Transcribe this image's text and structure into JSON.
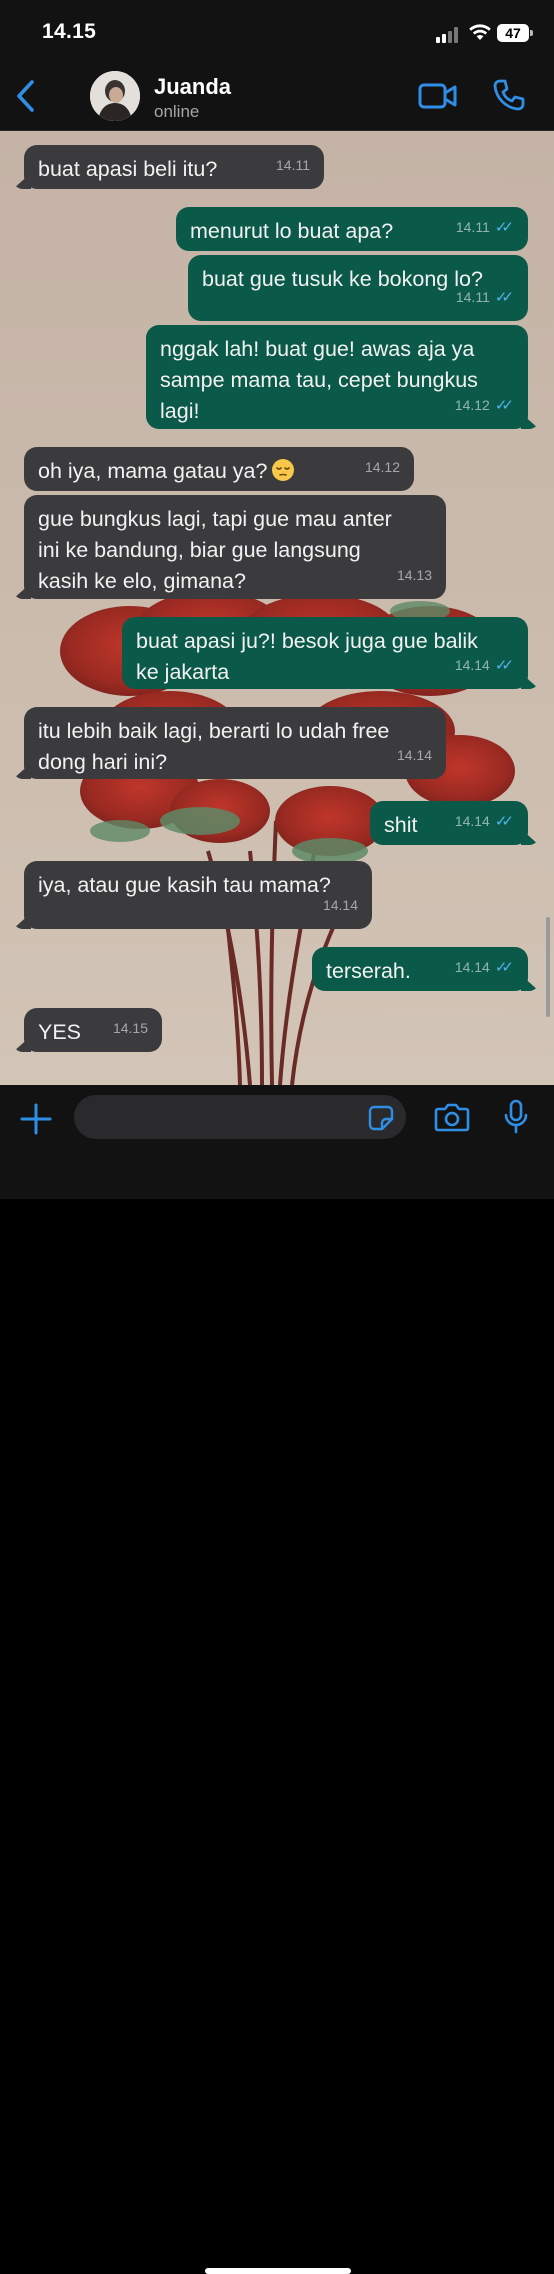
{
  "status_bar": {
    "time": "14.15",
    "battery": "47"
  },
  "header": {
    "contact_name": "Juanda",
    "contact_status": "online"
  },
  "messages": [
    {
      "dir": "in",
      "text": "buat apasi beli itu?",
      "time": "14.11"
    },
    {
      "dir": "out",
      "text": "menurut lo buat apa?",
      "time": "14.11",
      "read": true
    },
    {
      "dir": "out",
      "text": "buat gue tusuk ke bokong lo?",
      "time": "14.11",
      "read": true
    },
    {
      "dir": "out",
      "text": "nggak lah! buat gue! awas aja ya\nsampe mama tau, cepet bungkus\nlagi!",
      "time": "14.12",
      "read": true
    },
    {
      "dir": "in",
      "text": "oh iya, mama gatau ya?",
      "time": "14.12",
      "emoji": "pensive-face"
    },
    {
      "dir": "in",
      "text": "gue bungkus lagi, tapi gue mau anter\nini ke bandung, biar gue langsung\nkasih ke elo, gimana?",
      "time": "14.13"
    },
    {
      "dir": "out",
      "text": "buat apasi ju?! besok juga gue balik\nke jakarta",
      "time": "14.14",
      "read": true
    },
    {
      "dir": "in",
      "text": "itu lebih baik lagi, berarti lo udah free\ndong hari ini?",
      "time": "14.14"
    },
    {
      "dir": "out",
      "text": "shit",
      "time": "14.14",
      "read": true
    },
    {
      "dir": "in",
      "text": "iya, atau gue kasih tau mama?",
      "time": "14.14"
    },
    {
      "dir": "out",
      "text": "terserah.",
      "time": "14.14",
      "read": true
    },
    {
      "dir": "in",
      "text": "YES",
      "time": "14.15"
    }
  ],
  "input": {
    "placeholder": ""
  },
  "colors": {
    "incoming_bubble": "#3b3b3d",
    "outgoing_bubble": "#0b5a49",
    "accent": "#2f8fe6",
    "read_ticks": "#4fb3f0"
  },
  "icons": [
    "back-chevron-icon",
    "video-call-icon",
    "phone-icon",
    "plus-icon",
    "sticker-icon",
    "camera-icon",
    "microphone-icon",
    "read-ticks-icon",
    "pensive-face-emoji"
  ]
}
